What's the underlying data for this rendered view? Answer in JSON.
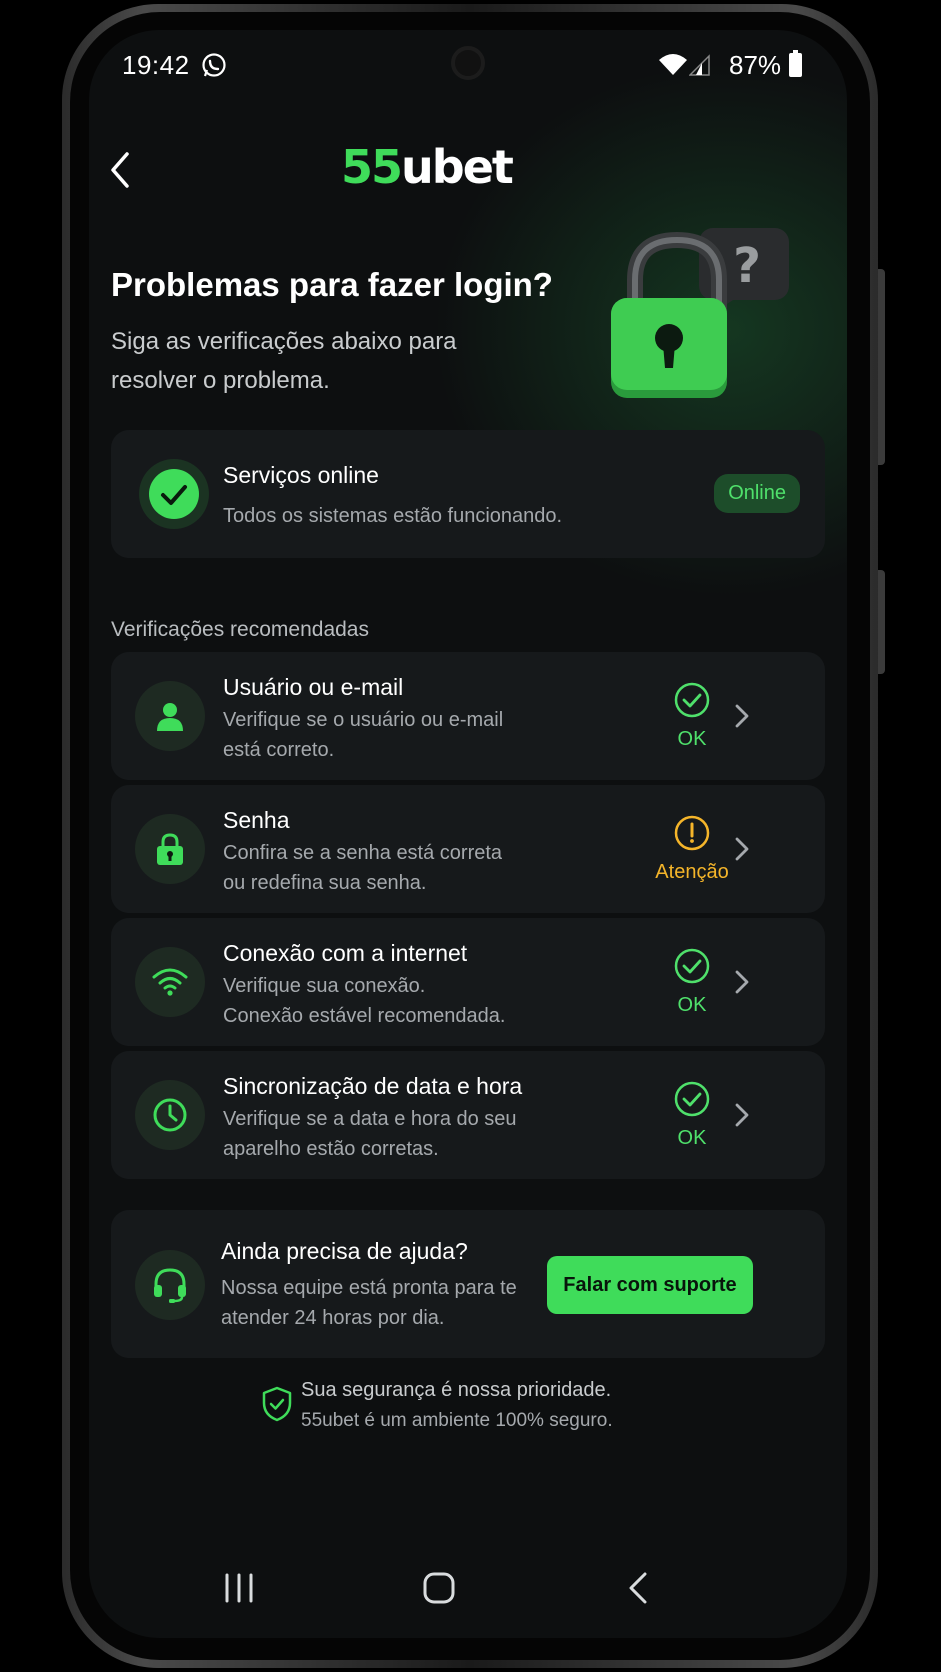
{
  "status_bar": {
    "time": "19:42",
    "battery": "87%"
  },
  "header": {
    "logo_green": "55",
    "logo_white": "ubet"
  },
  "hero": {
    "title": "Problemas para fazer login?",
    "subtitle": "Siga as verificações abaixo para resolver o problema."
  },
  "services": {
    "title": "Serviços online",
    "description": "Todos os sistemas estão funcionando.",
    "badge": "Online"
  },
  "section_label": "Verificações recomendadas",
  "checks": [
    {
      "title": "Usuário ou e-mail",
      "line1": "Verifique se o usuário ou e-mail",
      "line2": "está correto.",
      "status": "OK",
      "icon": "user-icon"
    },
    {
      "title": "Senha",
      "line1": "Confira se a senha está correta",
      "line2": "ou redefina sua senha.",
      "status": "Atenção",
      "icon": "lock-icon"
    },
    {
      "title": "Conexão com a internet",
      "line1": "Verifique sua conexão.",
      "line2": "Conexão estável recomendada.",
      "status": "OK",
      "icon": "wifi-icon"
    },
    {
      "title": "Sincronização de data e hora",
      "line1": "Verifique se a data e hora do seu",
      "line2": "aparelho estão corretas.",
      "status": "OK",
      "icon": "clock-icon"
    }
  ],
  "support": {
    "title": "Ainda precisa de ajuda?",
    "line1": "Nossa equipe está pronta para te",
    "line2": "atender 24 horas por dia.",
    "button": "Falar com suporte"
  },
  "security": {
    "title": "Sua segurança é nossa prioridade.",
    "subtitle": "55ubet é um ambiente 100% seguro."
  },
  "colors": {
    "accent": "#3fdc5a",
    "warning": "#f5b52a",
    "card": "#16191b",
    "background": "#0d0f10"
  }
}
